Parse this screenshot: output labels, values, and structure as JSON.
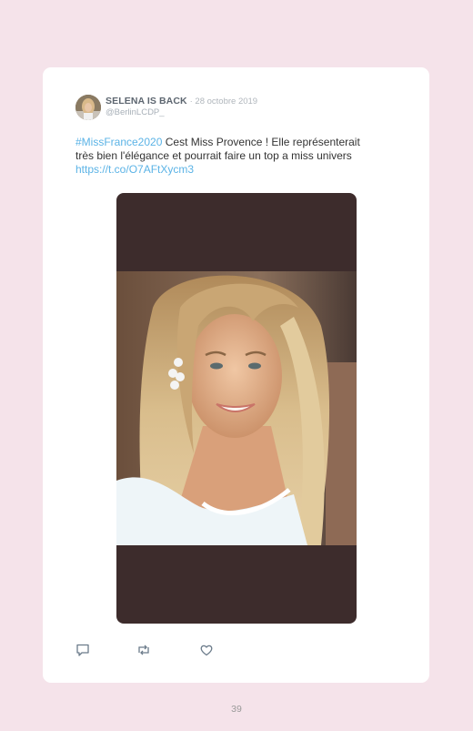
{
  "tweet": {
    "author_name": "SELENA IS BACK",
    "date": "· 28 octobre 2019",
    "handle": "@BerlinLCDP_",
    "hashtag": "#MissFrance2020",
    "text_line1": " Cest Miss Provence ! Elle représenterait",
    "text_line2": "très bien l'élégance et pourrait faire un top a miss univers",
    "link": "https://t.co/O7AFtXycm3",
    "media_description_icon": "photo-icon"
  },
  "actions": [
    {
      "name": "reply",
      "icon": "comment-icon"
    },
    {
      "name": "retweet",
      "icon": "retweet-icon"
    },
    {
      "name": "like",
      "icon": "heart-icon"
    }
  ],
  "colors": {
    "page_background": "#f5e3ea",
    "card": "#ffffff",
    "link": "#5bb3e6",
    "media_background": "#3d2c2c"
  },
  "page_number": "39"
}
